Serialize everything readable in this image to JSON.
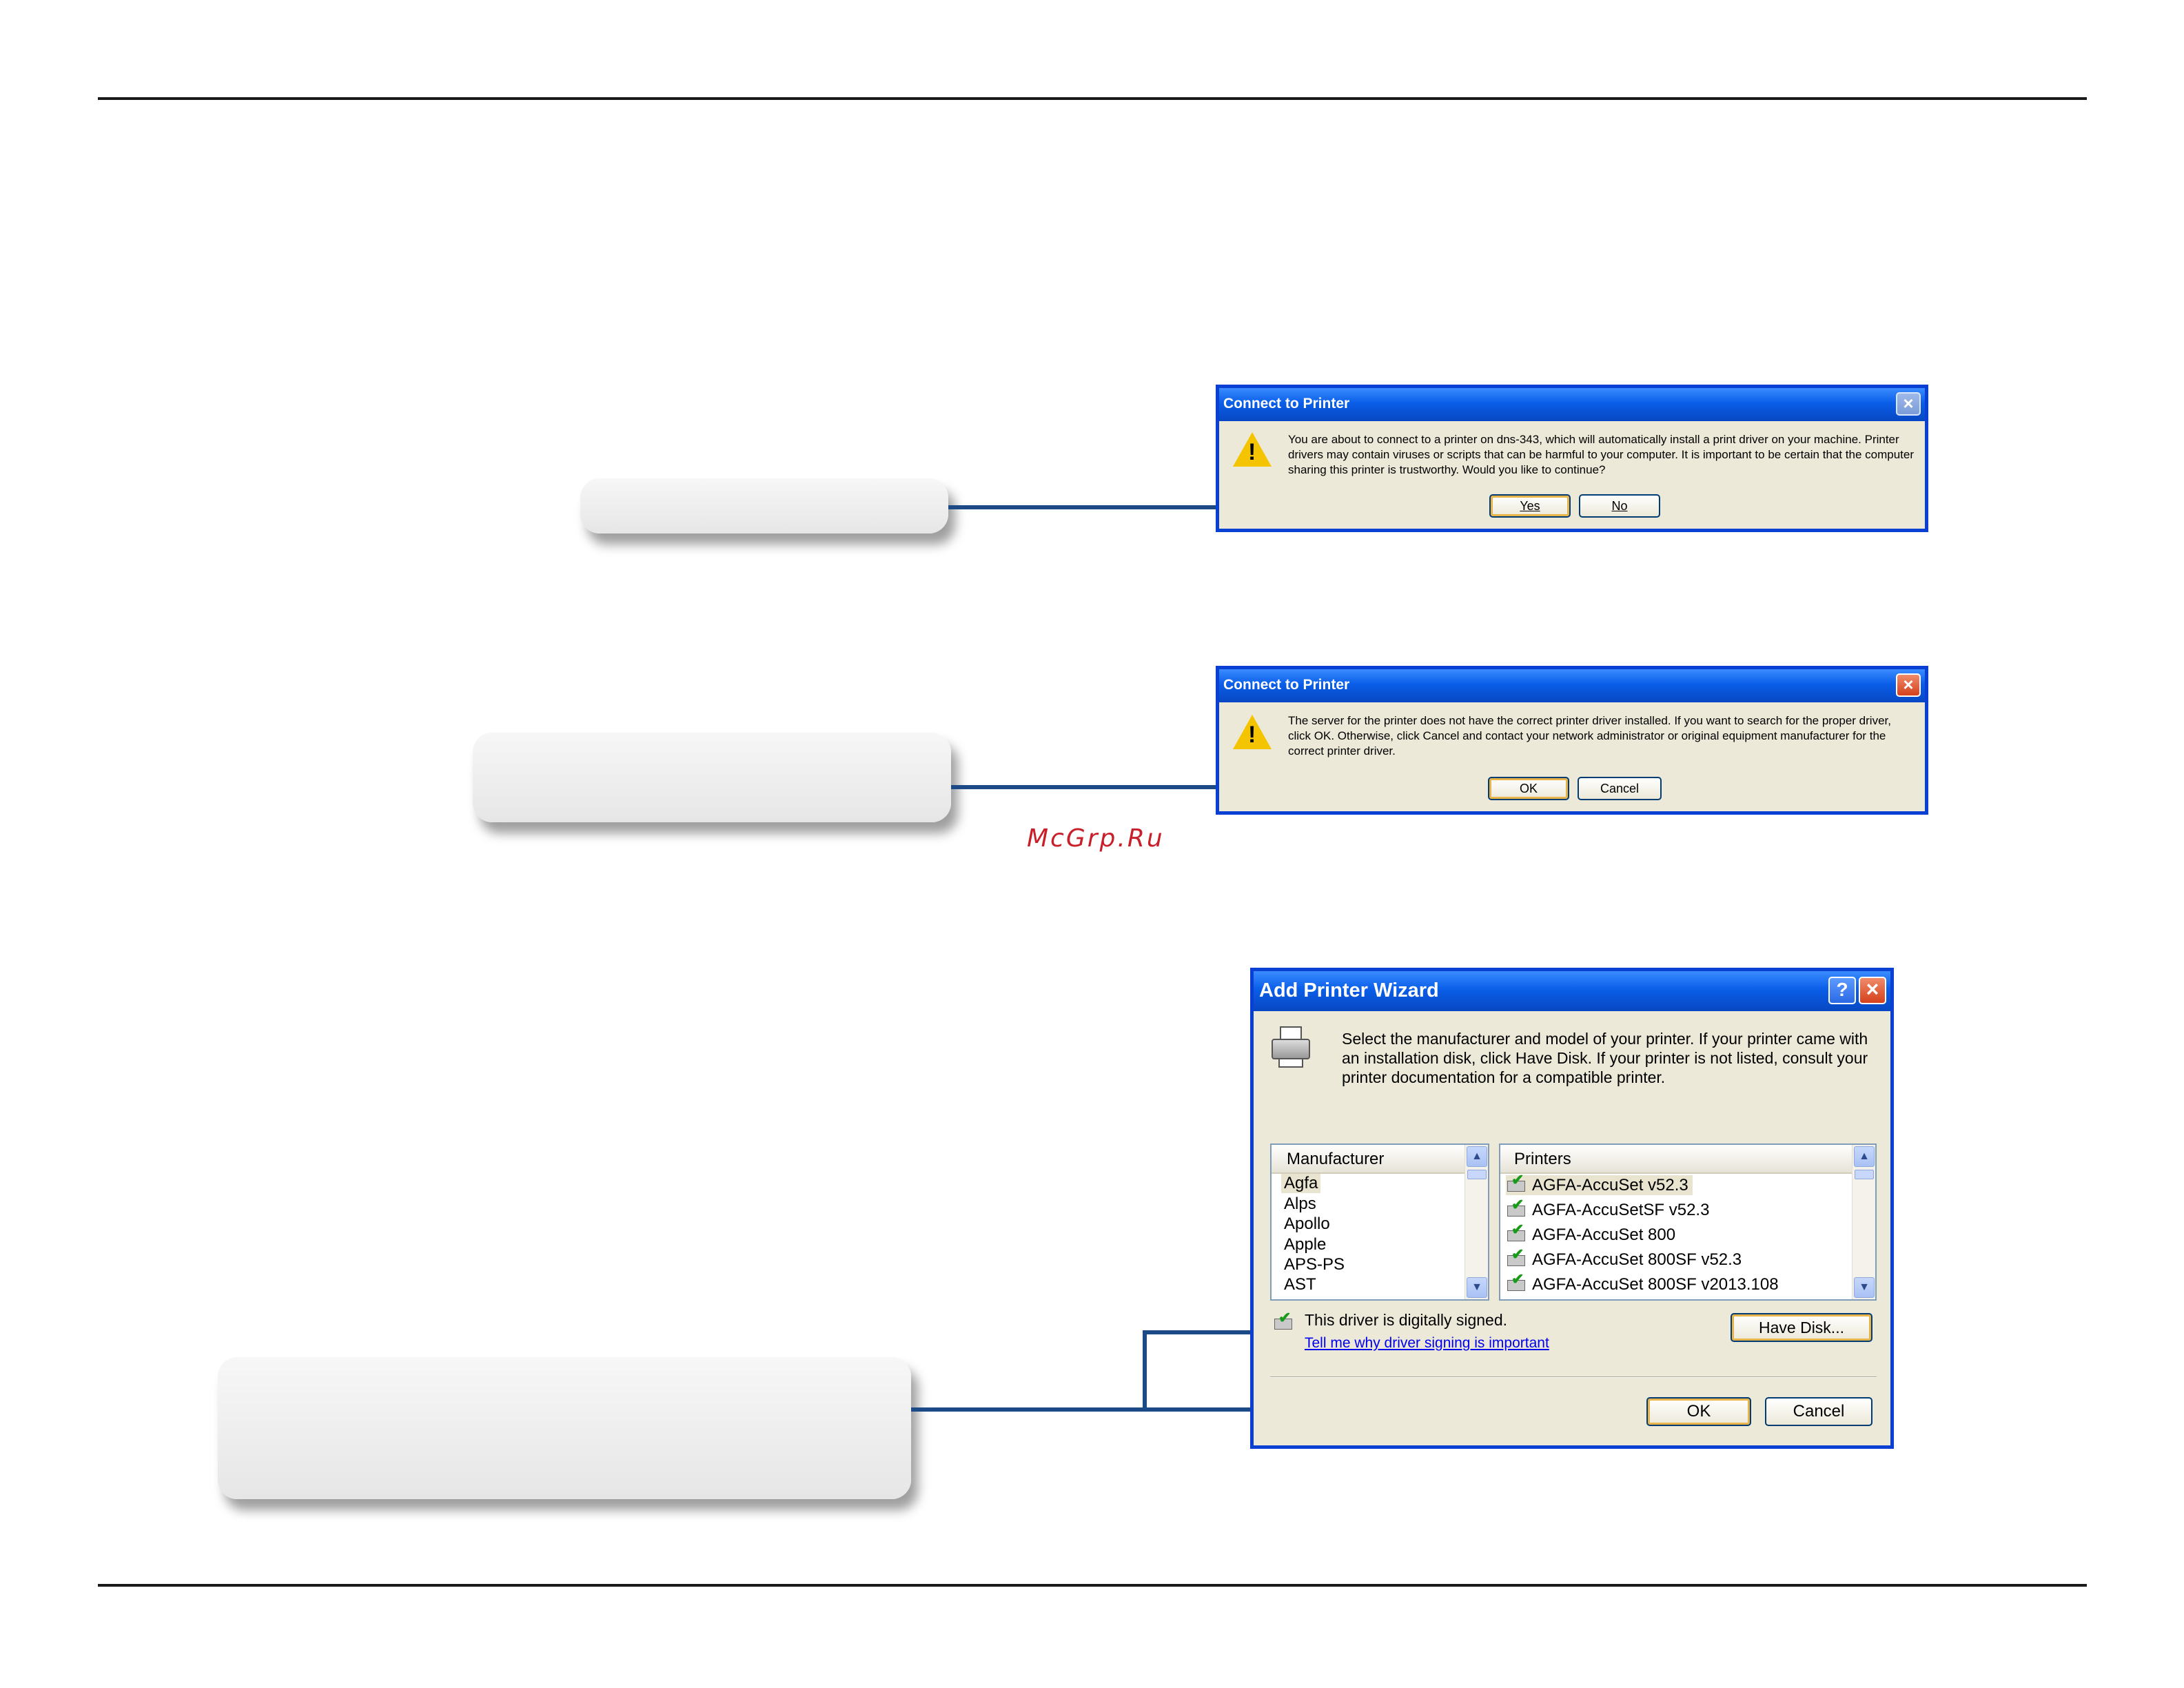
{
  "watermark": "McGrp.Ru",
  "dialog1": {
    "title": "Connect to Printer",
    "close_glyph": "×",
    "icon": "warning-icon",
    "message": "You are about to connect to a printer on dns-343, which will automatically install a print driver on your machine. Printer drivers may contain viruses or scripts that can be harmful to your computer.  It is important to be certain that the computer sharing this printer is trustworthy.  Would you like to continue?",
    "yes_label": "Yes",
    "no_label": "No"
  },
  "dialog2": {
    "title": "Connect to Printer",
    "close_glyph": "×",
    "icon": "warning-icon",
    "message": "The server for the printer does not have the correct printer driver installed.  If you want to search for the proper driver, click OK.  Otherwise, click Cancel and contact your network administrator or original equipment manufacturer for the correct printer driver.",
    "ok_label": "OK",
    "cancel_label": "Cancel"
  },
  "wizard": {
    "title": "Add Printer Wizard",
    "help_glyph": "?",
    "close_glyph": "×",
    "instructions": "Select the manufacturer and model of your printer. If your printer came with an installation disk, click Have Disk. If your printer is not listed, consult your printer documentation for a compatible printer.",
    "manufacturer_header": "Manufacturer",
    "manufacturers": [
      "Agfa",
      "Alps",
      "Apollo",
      "Apple",
      "APS-PS",
      "AST"
    ],
    "printers_header": "Printers",
    "printers": [
      "AGFA-AccuSet v52.3",
      "AGFA-AccuSetSF v52.3",
      "AGFA-AccuSet 800",
      "AGFA-AccuSet 800SF v52.3",
      "AGFA-AccuSet 800SF v2013.108"
    ],
    "signed_text": "This driver is digitally signed.",
    "signing_link": "Tell me why driver signing is important",
    "have_disk_label": "Have Disk...",
    "ok_label": "OK",
    "cancel_label": "Cancel"
  }
}
